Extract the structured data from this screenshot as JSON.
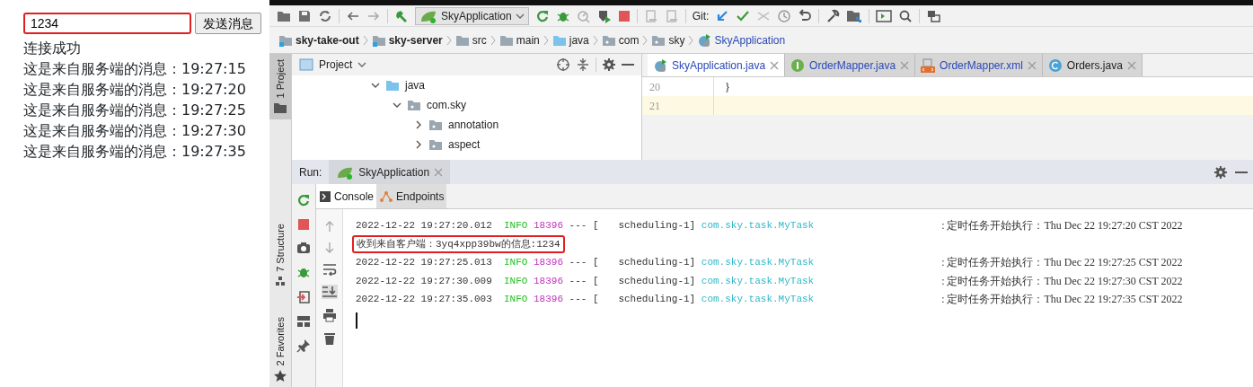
{
  "client": {
    "message_input": {
      "value": "1234",
      "highlighted": true
    },
    "send_button": "发送消息",
    "lines": [
      "连接成功",
      "这是来自服务端的消息：19:27:15",
      "这是来自服务端的消息：19:27:20",
      "这是来自服务端的消息：19:27:25",
      "这是来自服务端的消息：19:27:30",
      "这是来自服务端的消息：19:27:35"
    ]
  },
  "ide": {
    "toolbar": {
      "run_configuration": "SkyApplication",
      "vcs_label": "Git:"
    },
    "breadcrumbs": [
      {
        "label": "sky-take-out",
        "kind": "module"
      },
      {
        "label": "sky-server",
        "kind": "module"
      },
      {
        "label": "src",
        "kind": "folder"
      },
      {
        "label": "main",
        "kind": "folder"
      },
      {
        "label": "java",
        "kind": "source"
      },
      {
        "label": "com",
        "kind": "package"
      },
      {
        "label": "sky",
        "kind": "package"
      },
      {
        "label": "SkyApplication",
        "kind": "class"
      }
    ],
    "side_tools": [
      {
        "label": "1 Project",
        "selected": true
      },
      {
        "label": "7 Structure",
        "selected": false
      },
      {
        "label": "2 Favorites",
        "selected": false
      }
    ],
    "project_panel": {
      "title": "Project",
      "tree": [
        {
          "label": "java",
          "kind": "source",
          "expanded": true,
          "children": [
            {
              "label": "com.sky",
              "kind": "package",
              "expanded": true,
              "children": [
                {
                  "label": "annotation",
                  "kind": "package",
                  "expanded": false
                },
                {
                  "label": "aspect",
                  "kind": "package",
                  "expanded": false
                }
              ]
            }
          ]
        }
      ]
    },
    "editor_tabs": [
      {
        "label": "SkyApplication.java",
        "kind": "class",
        "selected": true,
        "modified": true
      },
      {
        "label": "OrderMapper.java",
        "kind": "interface",
        "selected": false,
        "modified": true
      },
      {
        "label": "OrderMapper.xml",
        "kind": "xml",
        "selected": false,
        "modified": true
      },
      {
        "label": "Orders.java",
        "kind": "class",
        "selected": false,
        "modified": false
      }
    ],
    "editor_lines": [
      {
        "number": "20",
        "code": "}",
        "current": false
      },
      {
        "number": "21",
        "current": true
      }
    ],
    "run_panel": {
      "label": "Run:",
      "tab": "SkyApplication",
      "console_tabs": [
        {
          "label": "Console",
          "selected": true
        },
        {
          "label": "Endpoints",
          "selected": false
        }
      ],
      "console_lines": [
        {
          "kind": "log",
          "timestamp": "2022-12-22 19:27:20.012",
          "level": "INFO",
          "pid": "18396",
          "separator": "--- [",
          "thread": "scheduling-1]",
          "logger": "com.sky.task.MyTask",
          "message": ": 定时任务开始执行：Thu Dec 22 19:27:20 CST 2022"
        },
        {
          "kind": "plain",
          "text": "收到来自客户端：3yq4xpp39bw的信息:1234",
          "highlighted": true
        },
        {
          "kind": "log",
          "timestamp": "2022-12-22 19:27:25.013",
          "level": "INFO",
          "pid": "18396",
          "separator": "--- [",
          "thread": "scheduling-1]",
          "logger": "com.sky.task.MyTask",
          "message": ": 定时任务开始执行：Thu Dec 22 19:27:25 CST 2022"
        },
        {
          "kind": "log",
          "timestamp": "2022-12-22 19:27:30.009",
          "level": "INFO",
          "pid": "18396",
          "separator": "--- [",
          "thread": "scheduling-1]",
          "logger": "com.sky.task.MyTask",
          "message": ": 定时任务开始执行：Thu Dec 22 19:27:30 CST 2022"
        },
        {
          "kind": "log",
          "timestamp": "2022-12-22 19:27:35.003",
          "level": "INFO",
          "pid": "18396",
          "separator": "--- [",
          "thread": "scheduling-1]",
          "logger": "com.sky.task.MyTask",
          "message": ": 定时任务开始执行：Thu Dec 22 19:27:35 CST 2022"
        }
      ]
    }
  }
}
